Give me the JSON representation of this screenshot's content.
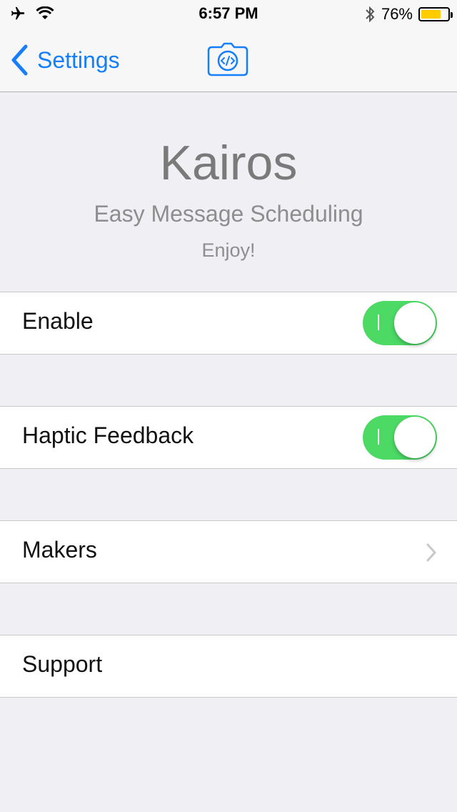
{
  "status_bar": {
    "time": "6:57 PM",
    "battery_percent": "76%",
    "battery_level": 0.76,
    "icons": [
      "airplane-icon",
      "wifi-icon",
      "bluetooth-icon",
      "battery-icon"
    ]
  },
  "nav": {
    "back_label": "Settings",
    "back_icon": "chevron-left-icon",
    "center_icon": "camera-code-icon",
    "accent_color": "#157efb"
  },
  "header": {
    "title": "Kairos",
    "subtitle": "Easy Message Scheduling",
    "tagline": "Enjoy!"
  },
  "cells": [
    {
      "label": "Enable",
      "accessory": "toggle",
      "on": true
    },
    {
      "label": "Haptic Feedback",
      "accessory": "toggle",
      "on": true
    },
    {
      "label": "Makers",
      "accessory": "chevron-right-icon"
    },
    {
      "label": "Support",
      "accessory": "none"
    }
  ],
  "colors": {
    "toggle_on": "#4cd964",
    "background": "#efeff4"
  }
}
